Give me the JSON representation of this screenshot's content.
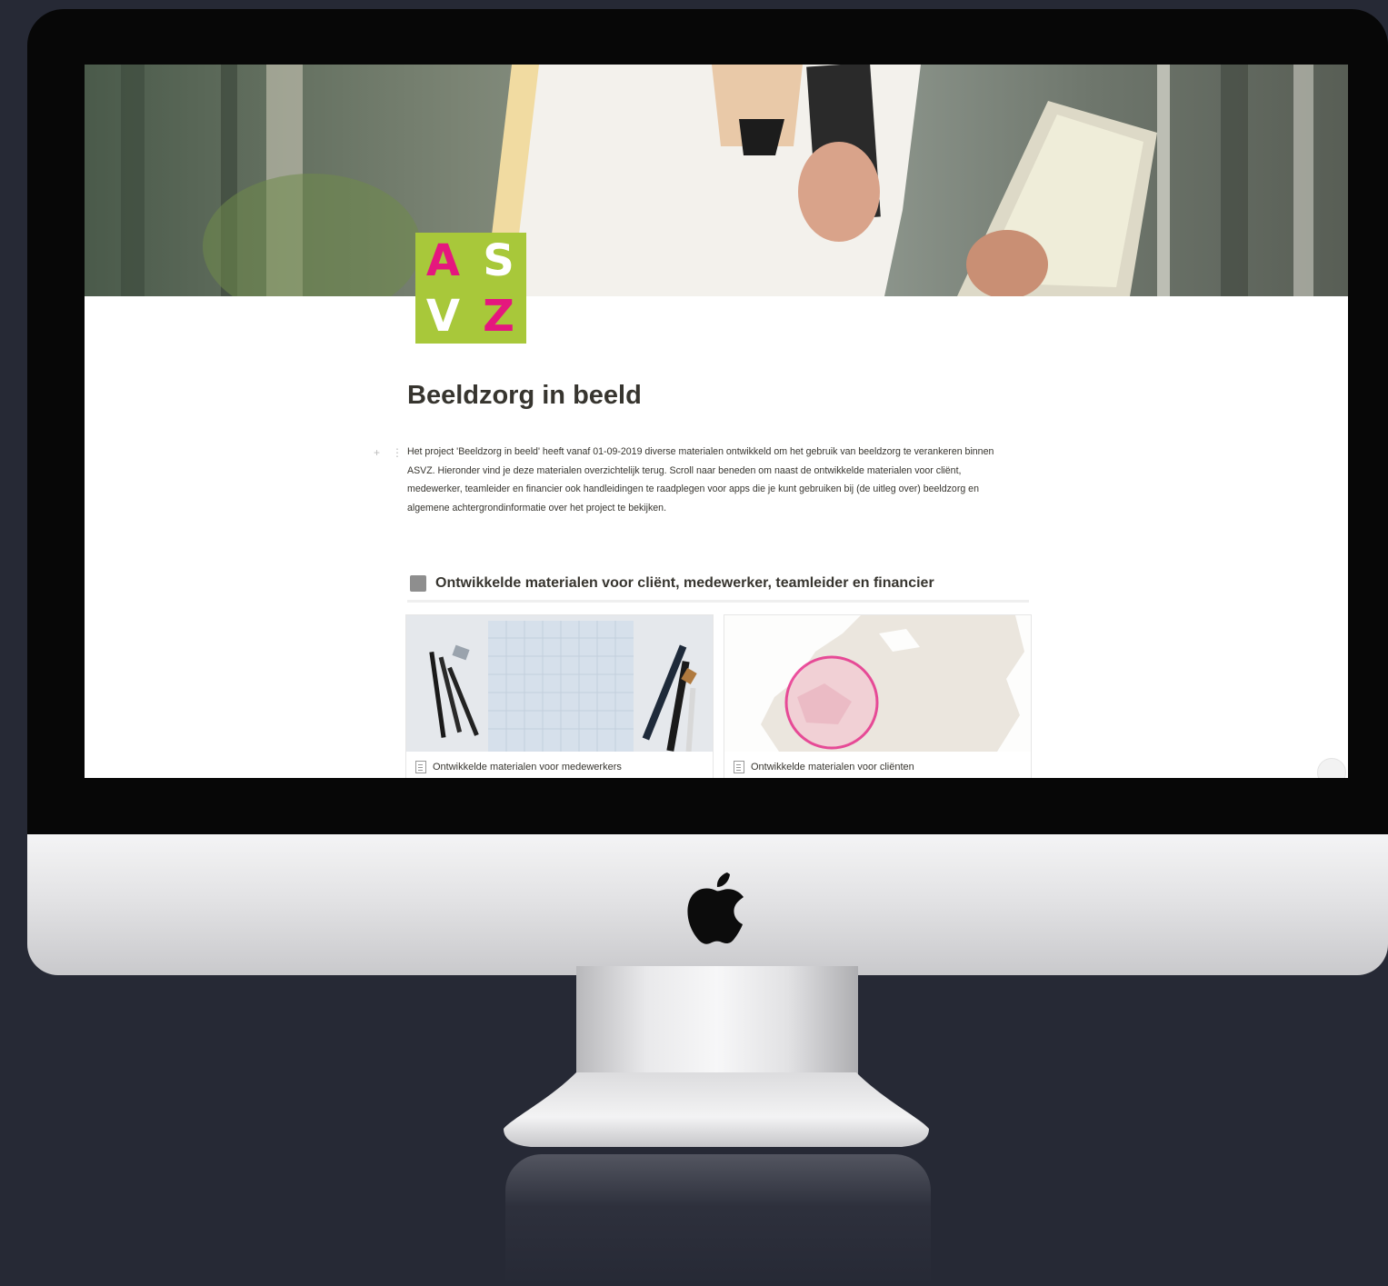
{
  "page": {
    "logo": {
      "letters": [
        "A",
        "S",
        "V",
        "Z"
      ],
      "colors": {
        "background": "#a8c83a",
        "pink": "#e5177e",
        "white": "#ffffff"
      }
    },
    "title": "Beeldzorg in beeld",
    "intro": "Het project 'Beeldzorg in beeld' heeft vanaf 01-09-2019 diverse materialen ontwikkeld om het gebruik van beeldzorg te verankeren binnen ASVZ. Hieronder vind je deze materialen overzichtelijk terug. Scroll naar beneden om naast de ontwikkelde materialen voor cliënt, medewerker, teamleider en financier ook handleidingen te raadplegen voor apps die je kunt gebruiken bij (de uitleg over) beeldzorg en algemene achtergrondinformatie over het project te bekijken.",
    "section": {
      "icon": "gray-square-icon",
      "title": "Ontwikkelde materialen voor cliënt, medewerker, teamleider en financier"
    },
    "cards": [
      {
        "label": "Ontwikkelde materialen voor medewerkers",
        "image": "notebook-and-pens-illustration",
        "icon": "page-icon"
      },
      {
        "label": "Ontwikkelde materialen voor cliënten",
        "image": "map-with-pink-circle-illustration",
        "icon": "page-icon"
      }
    ]
  },
  "device": {
    "type": "imac",
    "logo_icon": "apple-icon"
  }
}
